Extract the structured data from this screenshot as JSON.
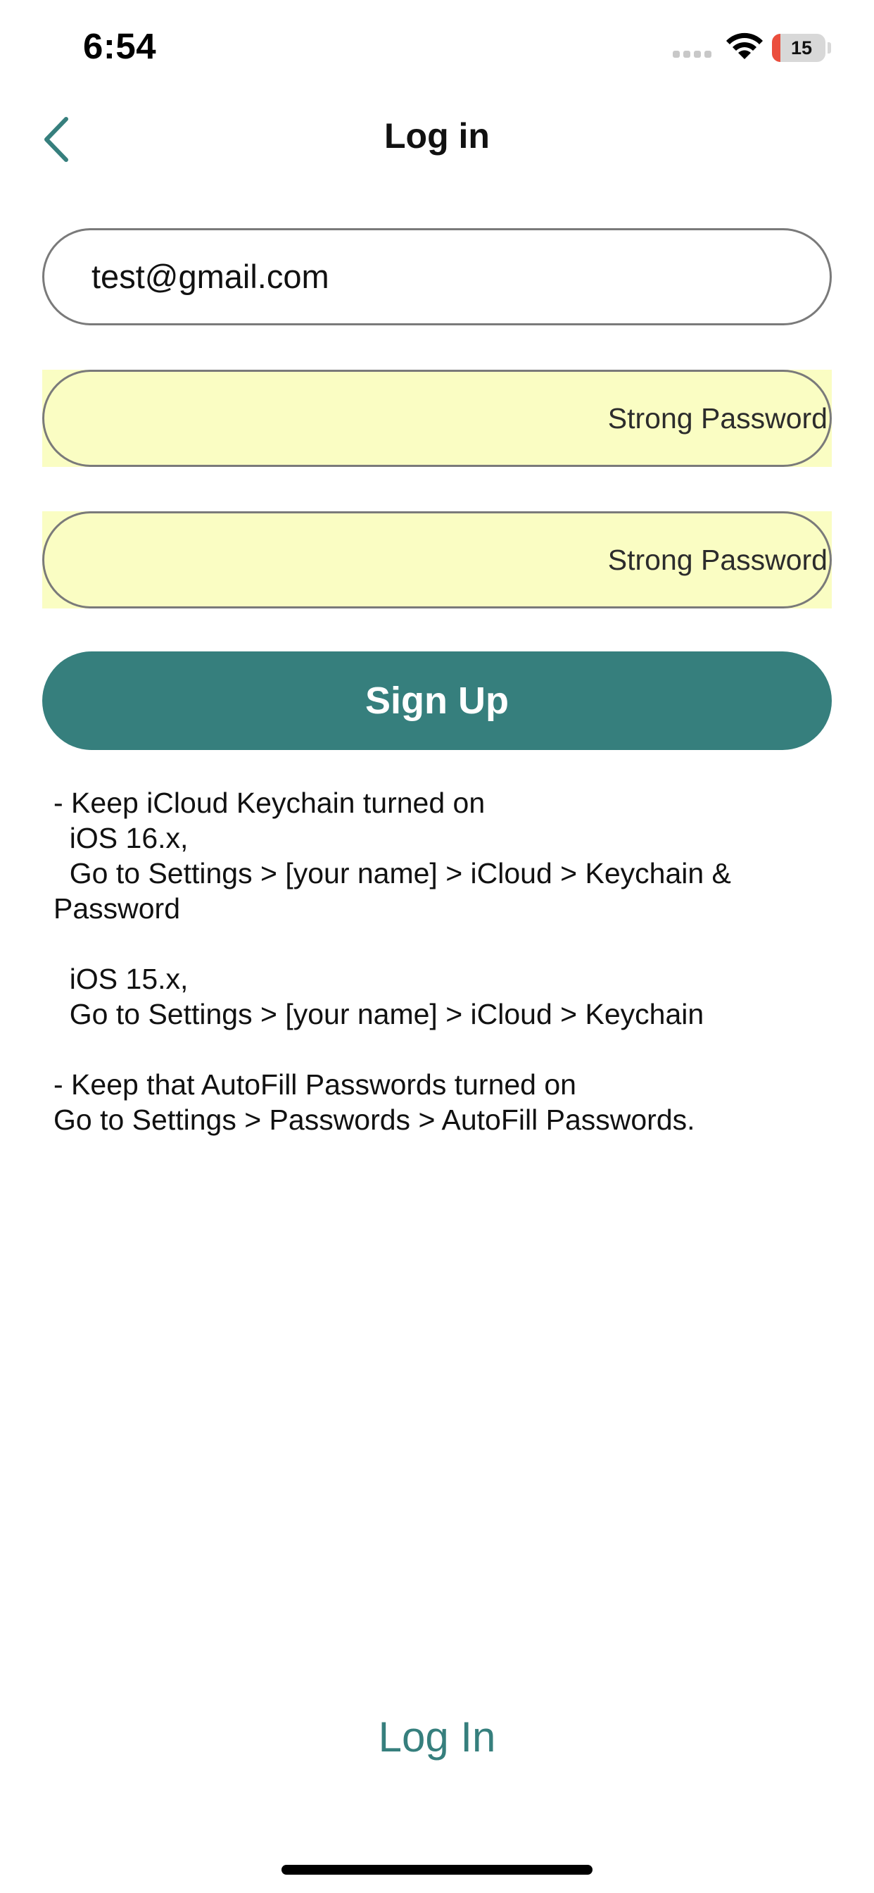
{
  "status_bar": {
    "time": "6:54",
    "battery_level": "15",
    "icons": [
      "signal-icon",
      "wifi-icon",
      "battery-icon"
    ]
  },
  "nav": {
    "title": "Log in",
    "back_icon": "chevron-left-icon"
  },
  "form": {
    "email_value": "test@gmail.com",
    "password_label": "Strong Password",
    "confirm_password_label": "Strong Password",
    "signup_label": "Sign Up"
  },
  "instructions": {
    "text": "- Keep iCloud Keychain turned on\n  iOS 16.x,\n  Go to Settings > [your name] > iCloud > Keychain &\nPassword\n\n  iOS 15.x,\n  Go to Settings > [your name] > iCloud > Keychain\n\n- Keep that AutoFill Passwords turned on\nGo to Settings > Passwords > AutoFill Passwords."
  },
  "footer": {
    "login_label": "Log In"
  },
  "colors": {
    "accent": "#367f7d",
    "autofill_bg": "#fafdc3",
    "field_border": "#7a7a7a",
    "battery_low": "#eb4e3d"
  }
}
